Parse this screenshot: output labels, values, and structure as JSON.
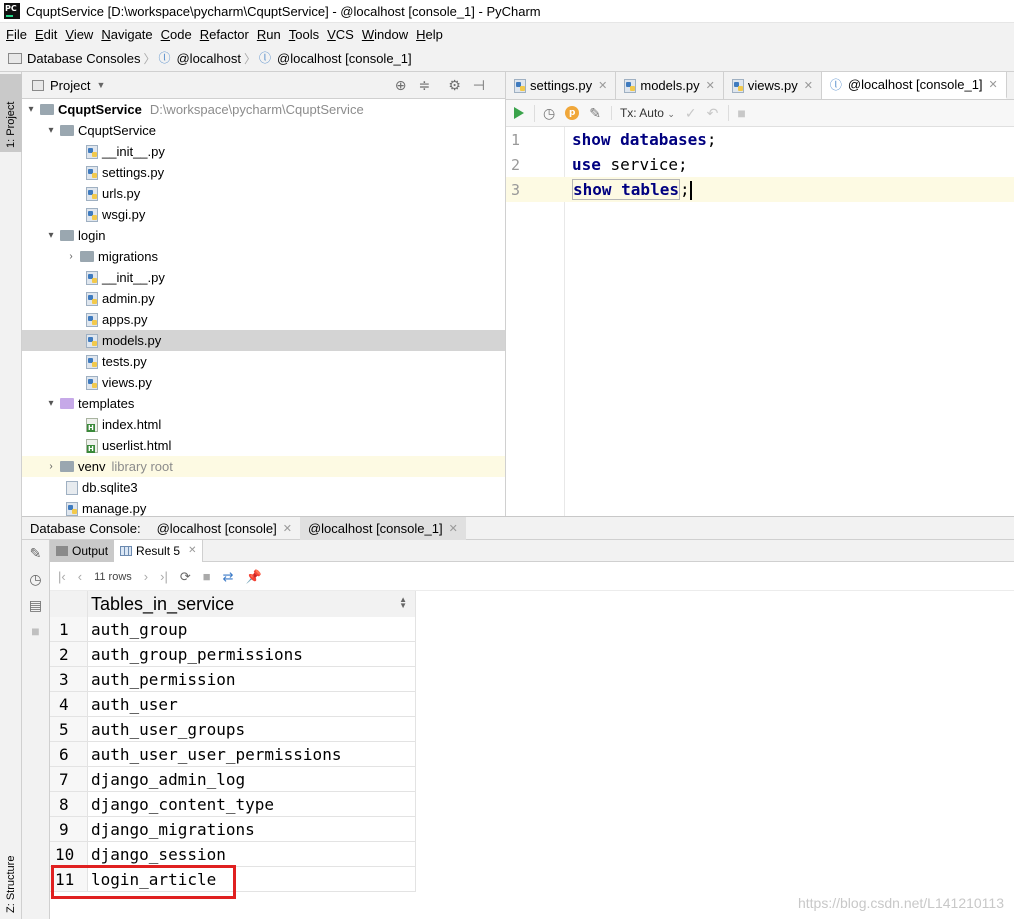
{
  "window": {
    "title": "CquptService [D:\\workspace\\pycharm\\CquptService] - @localhost [console_1] - PyCharm"
  },
  "menu": [
    {
      "u": "F",
      "rest": "ile"
    },
    {
      "u": "E",
      "rest": "dit"
    },
    {
      "u": "V",
      "rest": "iew"
    },
    {
      "u": "N",
      "rest": "avigate"
    },
    {
      "u": "C",
      "rest": "ode"
    },
    {
      "u": "R",
      "rest": "efactor"
    },
    {
      "u": "R",
      "rest": "un"
    },
    {
      "u": "T",
      "rest": "ools"
    },
    {
      "u": "V",
      "rest": "CS"
    },
    {
      "u": "W",
      "rest": "indow"
    },
    {
      "u": "H",
      "rest": "elp"
    }
  ],
  "breadcrumb": {
    "root": "Database Consoles",
    "host": "@localhost",
    "console": "@localhost [console_1]"
  },
  "left_strip": {
    "project_tab": "1: Project",
    "structure_tab": "Z: Structure"
  },
  "project": {
    "header": "Project",
    "root_name": "CquptService",
    "root_path": "D:\\workspace\\pycharm\\CquptService",
    "tree": {
      "cquptservice_folder": "CquptService",
      "init1": "__init__.py",
      "settings": "settings.py",
      "urls": "urls.py",
      "wsgi": "wsgi.py",
      "login_folder": "login",
      "migrations": "migrations",
      "init2": "__init__.py",
      "admin": "admin.py",
      "apps": "apps.py",
      "models": "models.py",
      "tests": "tests.py",
      "views": "views.py",
      "templates": "templates",
      "index_html": "index.html",
      "userlist_html": "userlist.html",
      "venv": "venv",
      "venv_note": "library root",
      "db": "db.sqlite3",
      "manage": "manage.py"
    }
  },
  "editor": {
    "tabs": [
      {
        "label": "settings.py"
      },
      {
        "label": "models.py"
      },
      {
        "label": "views.py"
      },
      {
        "label": "@localhost [console_1]"
      }
    ],
    "tx_mode": "Tx: Auto",
    "lines": {
      "n1": "1",
      "n2": "2",
      "n3": "3",
      "l1_kw": "show databases",
      "l1_end": ";",
      "l2_kw": "use",
      "l2_rest": " service;",
      "l3_kw": "show tables",
      "l3_end": ";"
    }
  },
  "bottom": {
    "title": "Database Console:",
    "tabs": [
      {
        "label": "@localhost [console]"
      },
      {
        "label": "@localhost [console_1]"
      }
    ],
    "subtabs": {
      "output": "Output",
      "result": "Result 5"
    },
    "rows_label": "11 rows",
    "column": "Tables_in_service",
    "rows": [
      {
        "n": "1",
        "v": "auth_group"
      },
      {
        "n": "2",
        "v": "auth_group_permissions"
      },
      {
        "n": "3",
        "v": "auth_permission"
      },
      {
        "n": "4",
        "v": "auth_user"
      },
      {
        "n": "5",
        "v": "auth_user_groups"
      },
      {
        "n": "6",
        "v": "auth_user_user_permissions"
      },
      {
        "n": "7",
        "v": "django_admin_log"
      },
      {
        "n": "8",
        "v": "django_content_type"
      },
      {
        "n": "9",
        "v": "django_migrations"
      },
      {
        "n": "10",
        "v": "django_session"
      },
      {
        "n": "11",
        "v": "login_article"
      }
    ]
  },
  "watermark": "https://blog.csdn.net/L141210113",
  "colors": {
    "keyword": "#000080",
    "highlight_box": "#e02020",
    "current_line": "#fdfae3",
    "run": "#3aa34b"
  }
}
